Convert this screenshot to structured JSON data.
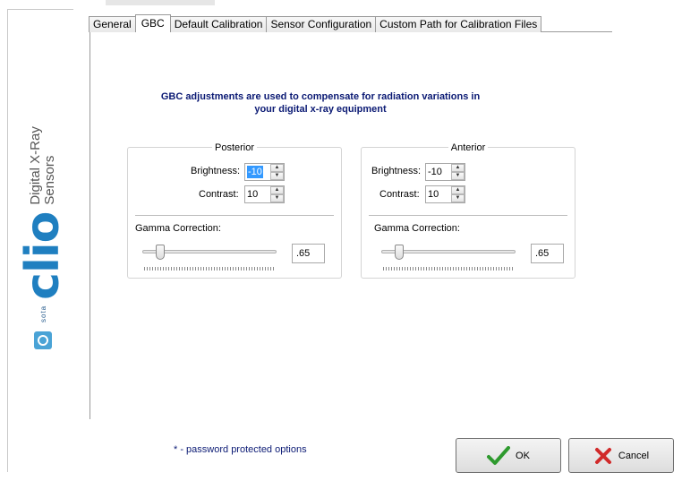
{
  "brand": {
    "product": "clio",
    "subtitle_line1": "Digital X-Ray",
    "subtitle_line2": "Sensors",
    "company": "sota",
    "accent_color": "#1f7fc0"
  },
  "tabs": [
    {
      "label": "General"
    },
    {
      "label": "GBC",
      "active": true
    },
    {
      "label": "Default Calibration"
    },
    {
      "label": "Sensor Configuration"
    },
    {
      "label": "Custom Path for Calibration Files"
    }
  ],
  "description_line1": "GBC adjustments are used to compensate for radiation variations in",
  "description_line2": "your digital x-ray equipment",
  "posterior": {
    "title": "Posterior",
    "brightness_label": "Brightness:",
    "brightness_value": "-10",
    "contrast_label": "Contrast:",
    "contrast_value": "10",
    "gamma_label": "Gamma Correction:",
    "gamma_value": ".65",
    "gamma_slider_fraction": 0.13
  },
  "anterior": {
    "title": "Anterior",
    "brightness_label": "Brightness:",
    "brightness_value": "-10",
    "contrast_label": "Contrast:",
    "contrast_value": "10",
    "gamma_label": "Gamma Correction:",
    "gamma_value": ".65",
    "gamma_slider_fraction": 0.13
  },
  "password_note": "* - password protected options",
  "buttons": {
    "ok": "OK",
    "cancel": "Cancel"
  },
  "icons": {
    "ok": "green-checkmark-icon",
    "cancel": "red-x-icon"
  }
}
